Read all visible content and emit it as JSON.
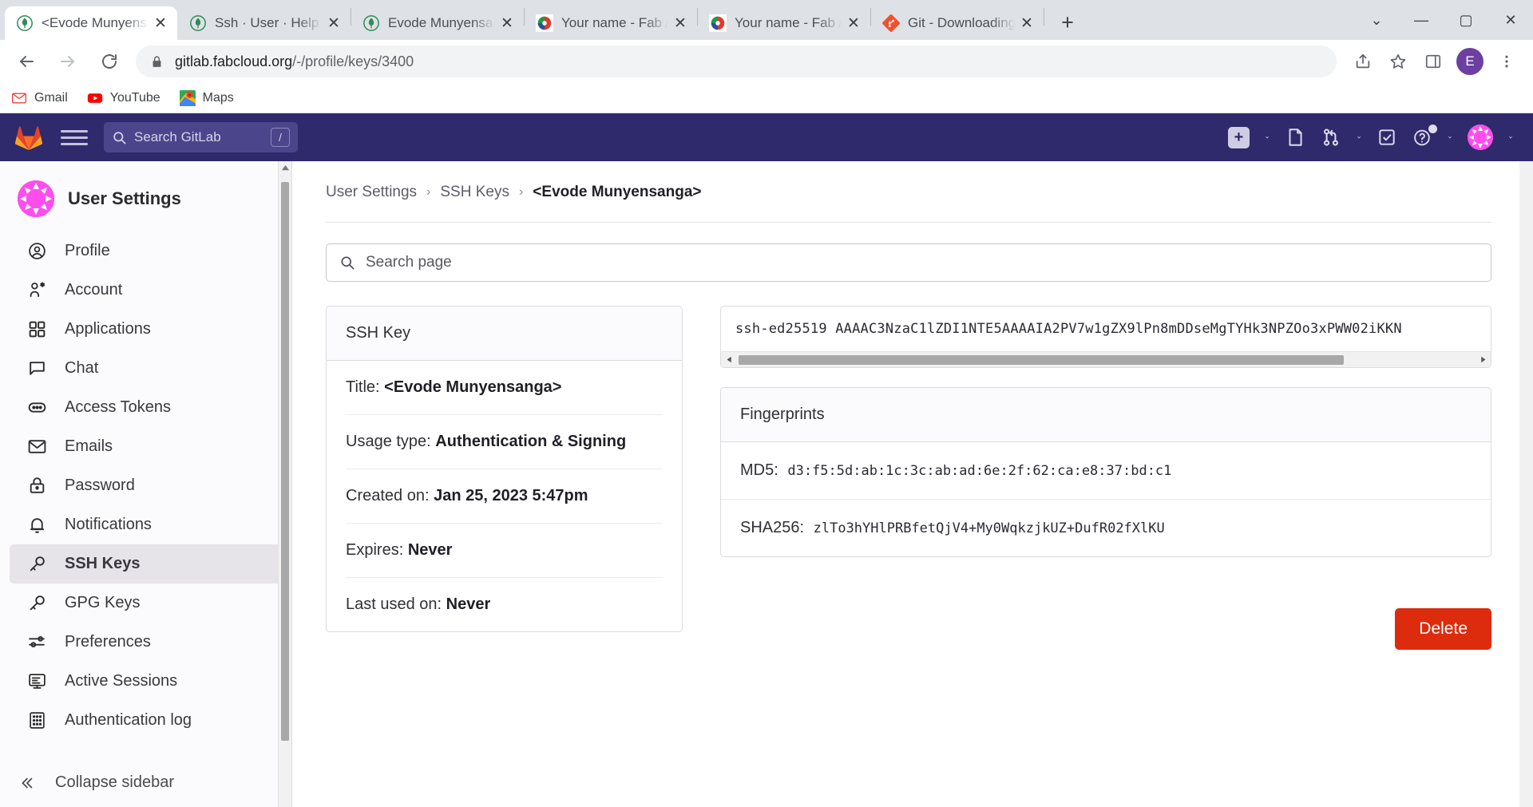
{
  "browser": {
    "tabs": [
      {
        "title": "<Evode Munyensan",
        "favicon": "gitlab-tanuki-green-icon",
        "active": true
      },
      {
        "title": "Ssh · User · Help · G",
        "favicon": "gitlab-tanuki-green-icon",
        "active": false
      },
      {
        "title": "Evode Munyensang",
        "favicon": "gitlab-tanuki-green-icon",
        "active": false
      },
      {
        "title": "Your name - Fab Ac",
        "favicon": "fabacademy-icon",
        "active": false
      },
      {
        "title": "Your name - Fab Ac",
        "favicon": "fabacademy-icon",
        "active": false
      },
      {
        "title": "Git - Downloading P",
        "favicon": "git-logo-icon",
        "active": false
      }
    ],
    "new_tab_label": "+",
    "window_controls": [
      "⌄",
      "—",
      "▢",
      "✕"
    ],
    "url": "gitlab.fabcloud.org",
    "url_path": "/-/profile/keys/3400",
    "bookmarks": [
      {
        "label": "Gmail",
        "icon": "gmail-icon"
      },
      {
        "label": "YouTube",
        "icon": "youtube-icon"
      },
      {
        "label": "Maps",
        "icon": "google-maps-icon"
      }
    ]
  },
  "gitlab_nav": {
    "search_placeholder": "Search GitLab",
    "search_shortcut": "/",
    "brand_color": "#2f2a6b",
    "icons": [
      "plus-square-icon",
      "chevron-down-icon",
      "issues-icon",
      "merge-requests-icon",
      "chevron-down-icon",
      "todos-icon",
      "help-icon",
      "chevron-down-icon",
      "user-avatar",
      "chevron-down-icon"
    ]
  },
  "sidebar": {
    "title": "User Settings",
    "items": [
      {
        "label": "Profile",
        "icon": "profile-icon",
        "active": false
      },
      {
        "label": "Account",
        "icon": "account-icon",
        "active": false
      },
      {
        "label": "Applications",
        "icon": "applications-icon",
        "active": false
      },
      {
        "label": "Chat",
        "icon": "chat-icon",
        "active": false
      },
      {
        "label": "Access Tokens",
        "icon": "access-tokens-icon",
        "active": false
      },
      {
        "label": "Emails",
        "icon": "email-icon",
        "active": false
      },
      {
        "label": "Password",
        "icon": "lock-icon",
        "active": false
      },
      {
        "label": "Notifications",
        "icon": "bell-icon",
        "active": false
      },
      {
        "label": "SSH Keys",
        "icon": "key-icon",
        "active": true
      },
      {
        "label": "GPG Keys",
        "icon": "key-icon",
        "active": false
      },
      {
        "label": "Preferences",
        "icon": "preferences-icon",
        "active": false
      },
      {
        "label": "Active Sessions",
        "icon": "monitor-icon",
        "active": false
      },
      {
        "label": "Authentication log",
        "icon": "log-icon",
        "active": false
      }
    ],
    "collapse_label": "Collapse sidebar"
  },
  "breadcrumb": {
    "items": [
      "User Settings",
      "SSH Keys"
    ],
    "current": "<Evode Munyensanga>",
    "separator": "›"
  },
  "search_page": {
    "placeholder": "Search page",
    "icon": "search-icon"
  },
  "ssh_key_card": {
    "header": "SSH Key",
    "rows": [
      {
        "label": "Title:",
        "value": "<Evode Munyensanga>"
      },
      {
        "label": "Usage type:",
        "value": "Authentication & Signing"
      },
      {
        "label": "Created on:",
        "value": "Jan 25, 2023 5:47pm"
      },
      {
        "label": "Expires:",
        "value": "Never"
      },
      {
        "label": "Last used on:",
        "value": "Never"
      }
    ]
  },
  "key_value": "ssh-ed25519 AAAAC3NzaC1lZDI1NTE5AAAAIA2PV7w1gZX9lPn8mDDseMgTYHk3NPZOo3xPWW02iKKN",
  "fingerprints": {
    "header": "Fingerprints",
    "rows": [
      {
        "label": "MD5:",
        "value": "d3:f5:5d:ab:1c:3c:ab:ad:6e:2f:62:ca:e8:37:bd:c1"
      },
      {
        "label": "SHA256:",
        "value": "zlTo3hYHlPRBfetQjV4+My0WqkzjkUZ+DufR02fXlKU"
      }
    ]
  },
  "delete_button": {
    "label": "Delete",
    "color": "#dd2b0e"
  }
}
